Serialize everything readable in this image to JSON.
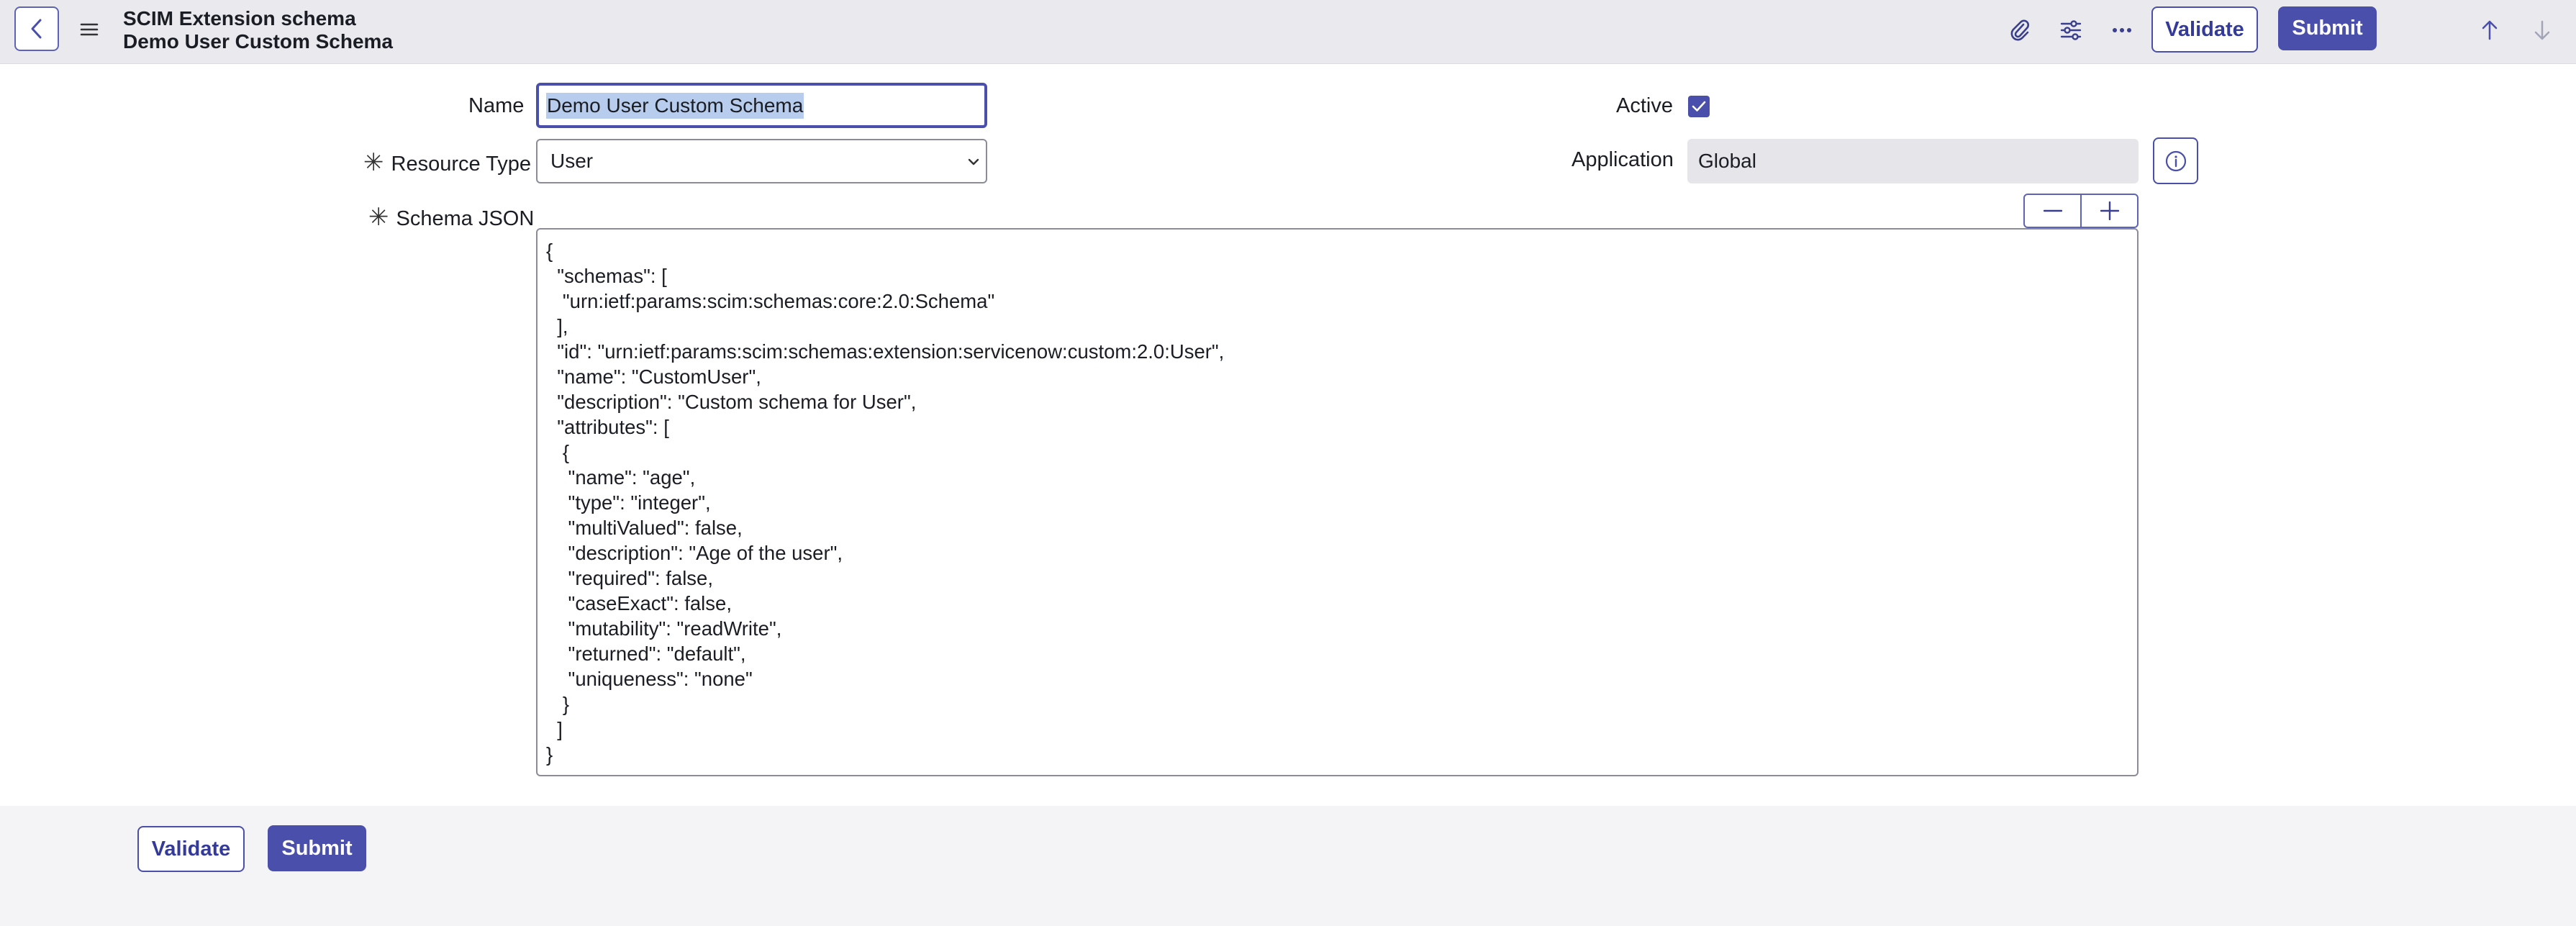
{
  "header": {
    "title_line1": "SCIM Extension schema",
    "title_line2": "Demo User Custom Schema",
    "validate_label": "Validate",
    "submit_label": "Submit",
    "icons": [
      "chevron-left-icon",
      "hamburger-menu-icon",
      "paperclip-icon",
      "sliders-icon",
      "more-horizontal-icon",
      "arrow-up-icon",
      "arrow-down-icon"
    ]
  },
  "form": {
    "name_label": "Name",
    "name_value": "Demo User Custom Schema",
    "resource_type_label": "Resource Type",
    "resource_type_value": "User",
    "schema_json_label": "Schema JSON",
    "required_marker": "✳",
    "active_label": "Active",
    "active_checked": true,
    "application_label": "Application",
    "application_value": "Global",
    "schema_json_lines": [
      "{",
      "  \"schemas\": [",
      "   \"urn:ietf:params:scim:schemas:core:2.0:Schema\"",
      "  ],",
      "  \"id\": \"urn:ietf:params:scim:schemas:extension:servicenow:custom:2.0:User\",",
      "  \"name\": \"CustomUser\",",
      "  \"description\": \"Custom schema for User\",",
      "  \"attributes\": [",
      "   {",
      "    \"name\": \"age\",",
      "    \"type\": \"integer\",",
      "    \"multiValued\": false,",
      "    \"description\": \"Age of the user\",",
      "    \"required\": false,",
      "    \"caseExact\": false,",
      "    \"mutability\": \"readWrite\",",
      "    \"returned\": \"default\",",
      "    \"uniqueness\": \"none\"",
      "   }",
      "  ]",
      "}"
    ]
  },
  "footer": {
    "validate_label": "Validate",
    "submit_label": "Submit"
  },
  "colors": {
    "accent": "#4a4fab",
    "header_bg": "#e9e9ee",
    "readonly_bg": "#e6e6ea",
    "selection": "#b8cdee"
  }
}
